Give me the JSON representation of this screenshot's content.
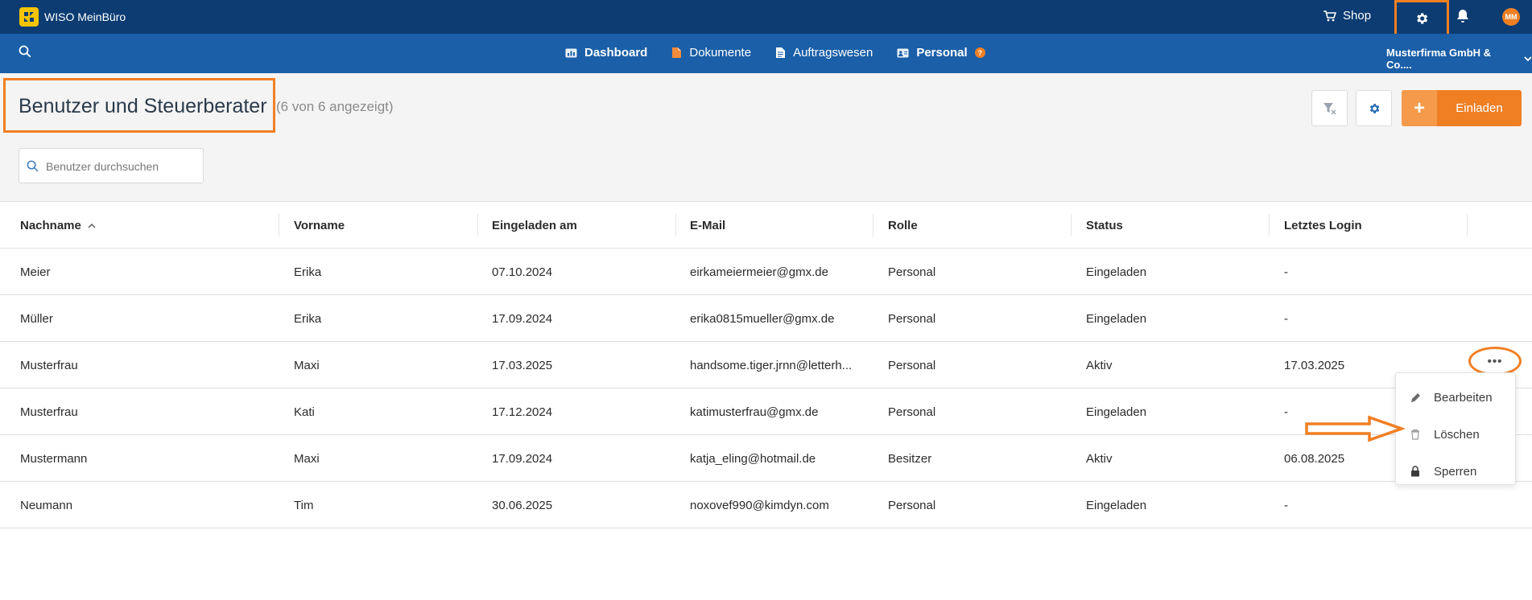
{
  "app": {
    "brand": "WISO MeinBüro",
    "shop_label": "Shop",
    "avatar_initials": "MM"
  },
  "colors": {
    "topbar": "#0c3c72",
    "navbar": "#1a5fa8",
    "accent": "#f07f24",
    "logo": "#f5c400"
  },
  "nav": {
    "items": [
      {
        "label": "Dashboard",
        "icon": "dashboard-icon"
      },
      {
        "label": "Dokumente",
        "icon": "documents-icon"
      },
      {
        "label": "Auftragswesen",
        "icon": "orders-icon"
      },
      {
        "label": "Personal",
        "icon": "personal-icon",
        "badge": "?"
      }
    ],
    "company": "Musterfirma GmbH & Co...."
  },
  "page": {
    "title": "Benutzer und Steuerberater",
    "count": "(6 von 6 angezeigt)",
    "invite_label": "Einladen",
    "invite_plus": "+",
    "search_placeholder": "Benutzer durchsuchen"
  },
  "table": {
    "columns": [
      "Nachname",
      "Vorname",
      "Eingeladen am",
      "E-Mail",
      "Rolle",
      "Status",
      "Letztes Login"
    ],
    "rows": [
      [
        "Meier",
        "Erika",
        "07.10.2024",
        "eirkameiermeier@gmx.de",
        "Personal",
        "Eingeladen",
        "-"
      ],
      [
        "Müller",
        "Erika",
        "17.09.2024",
        "erika0815mueller@gmx.de",
        "Personal",
        "Eingeladen",
        "-"
      ],
      [
        "Musterfrau",
        "Maxi",
        "17.03.2025",
        "handsome.tiger.jrnn@letterh...",
        "Personal",
        "Aktiv",
        "17.03.2025"
      ],
      [
        "Musterfrau",
        "Kati",
        "17.12.2024",
        "katimusterfrau@gmx.de",
        "Personal",
        "Eingeladen",
        "-"
      ],
      [
        "Mustermann",
        "Maxi",
        "17.09.2024",
        "katja_eling@hotmail.de",
        "Besitzer",
        "Aktiv",
        "06.08.2025"
      ],
      [
        "Neumann",
        "Tim",
        "30.06.2025",
        "noxovef990@kimdyn.com",
        "Personal",
        "Eingeladen",
        "-"
      ]
    ]
  },
  "row_menu": {
    "dots": "•••",
    "items": [
      {
        "label": "Bearbeiten",
        "icon": "pencil-icon"
      },
      {
        "label": "Löschen",
        "icon": "trash-icon"
      },
      {
        "label": "Sperren",
        "icon": "lock-icon"
      }
    ]
  }
}
